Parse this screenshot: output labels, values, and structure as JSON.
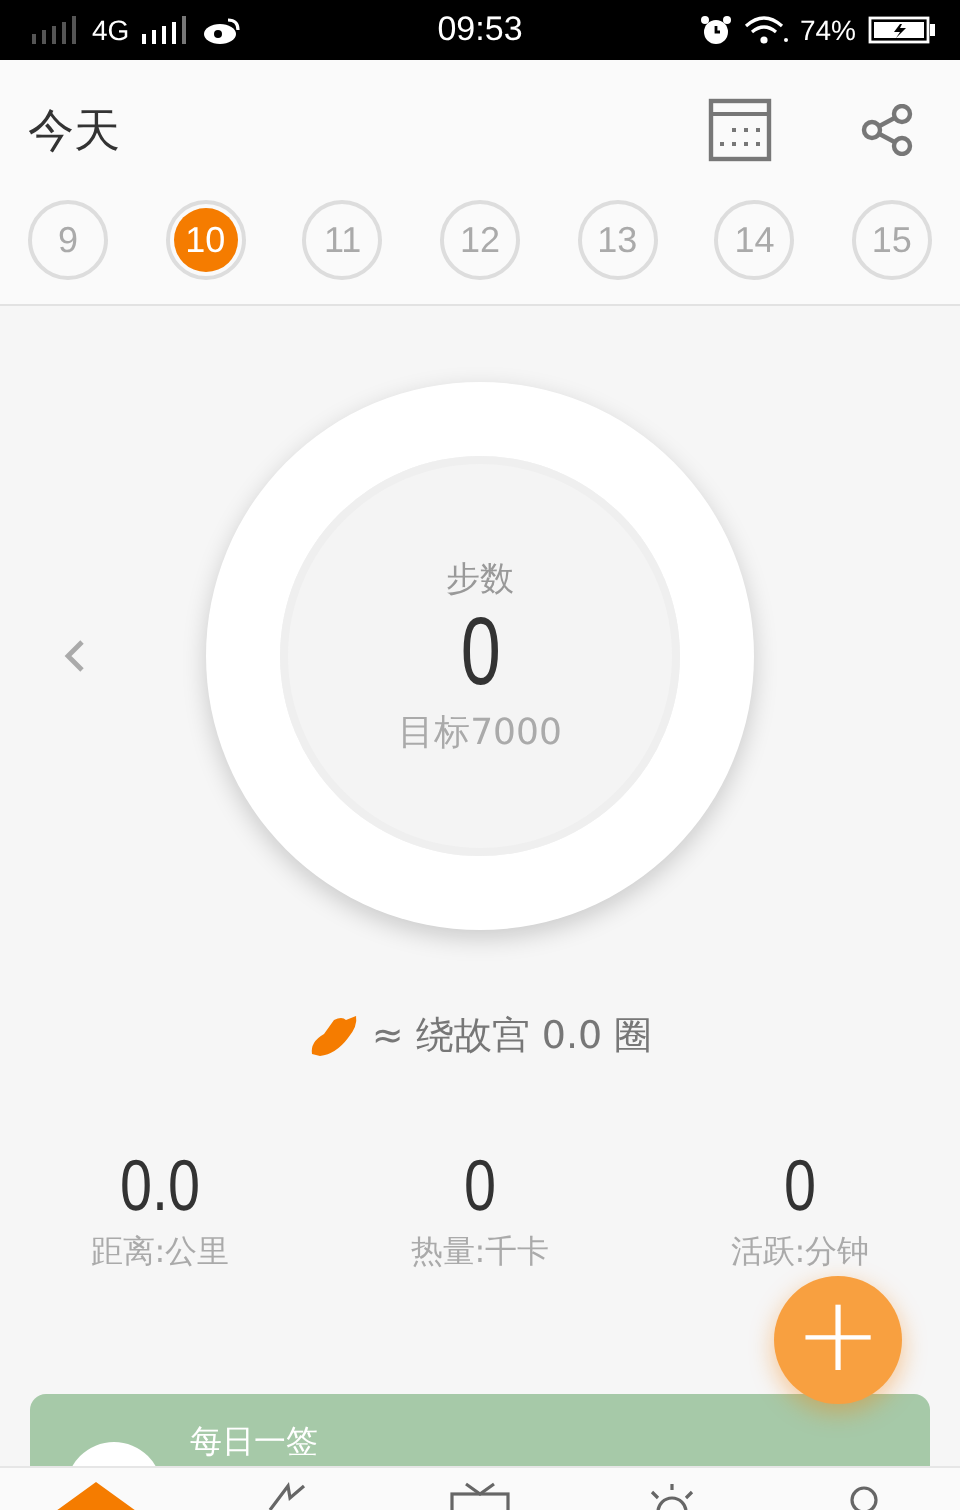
{
  "status_bar": {
    "network": "4G",
    "time": "09:53",
    "battery": "74%"
  },
  "header": {
    "title": "今天"
  },
  "dates": [
    {
      "label": "9",
      "selected": false
    },
    {
      "label": "10",
      "selected": true
    },
    {
      "label": "11",
      "selected": false
    },
    {
      "label": "12",
      "selected": false
    },
    {
      "label": "13",
      "selected": false
    },
    {
      "label": "14",
      "selected": false
    },
    {
      "label": "15",
      "selected": false
    }
  ],
  "steps": {
    "label": "步数",
    "value": "0",
    "goal": "目标7000"
  },
  "comparison": {
    "approx": "≈",
    "text": "绕故宫 0.0 圈"
  },
  "stats": [
    {
      "value": "0.0",
      "label": "距离:公里"
    },
    {
      "value": "0",
      "label": "热量:千卡"
    },
    {
      "value": "0",
      "label": "活跃:分钟"
    }
  ],
  "fab": {
    "symbol": "+"
  },
  "card": {
    "title": "每日一签"
  },
  "tabs": [
    {
      "kind": "home",
      "selected": true
    },
    {
      "kind": "bolt",
      "selected": false
    },
    {
      "kind": "tv",
      "selected": false
    },
    {
      "kind": "sun",
      "selected": false
    },
    {
      "kind": "person",
      "selected": false
    }
  ]
}
